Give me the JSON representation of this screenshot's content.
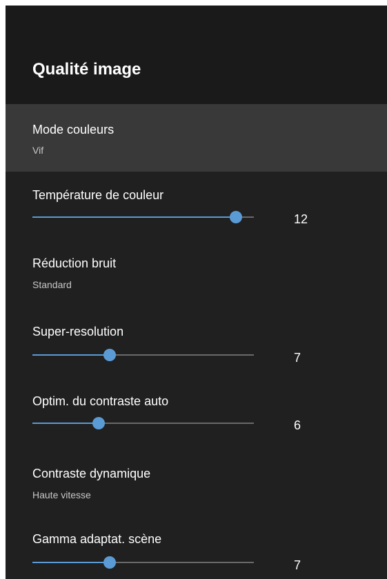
{
  "title": "Qualité image",
  "accent_color": "#5b9bd5",
  "items": {
    "color_mode": {
      "label": "Mode couleurs",
      "value": "Vif"
    },
    "color_temp": {
      "label": "Température de couleur",
      "value": "12",
      "level": 0.92
    },
    "noise_reduction": {
      "label": "Réduction bruit",
      "value": "Standard"
    },
    "super_resolution": {
      "label": "Super-resolution",
      "value": "7",
      "level": 0.35
    },
    "auto_contrast": {
      "label": "Optim. du contraste auto",
      "value": "6",
      "level": 0.3
    },
    "dynamic_contrast": {
      "label": "Contraste dynamique",
      "value": "Haute vitesse"
    },
    "gamma": {
      "label": "Gamma adaptat. scène",
      "value": "7",
      "level": 0.35
    }
  }
}
